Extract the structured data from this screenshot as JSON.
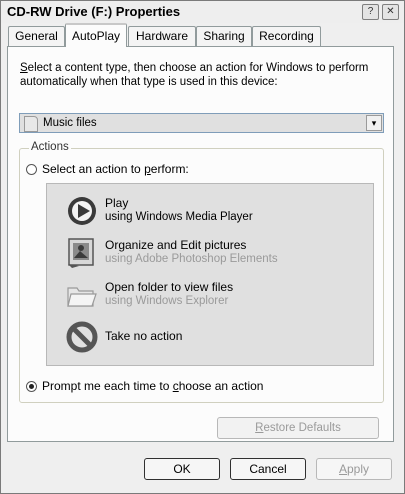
{
  "window": {
    "title": "CD-RW Drive (F:) Properties",
    "help_glyph": "?",
    "close_glyph": "✕"
  },
  "tabs": [
    {
      "label": "General",
      "active": false
    },
    {
      "label": "AutoPlay",
      "active": true
    },
    {
      "label": "Hardware",
      "active": false
    },
    {
      "label": "Sharing",
      "active": false
    },
    {
      "label": "Recording",
      "active": false
    }
  ],
  "description": {
    "before": "",
    "accel": "S",
    "after": "elect a content type, then choose an action for Windows to perform automatically when that type is used in this device:"
  },
  "content_type": {
    "selected": "Music files",
    "icon": "music-file-icon",
    "arrow": "▾"
  },
  "actions_group": {
    "label": "Actions",
    "select_action": {
      "before": "Select an action to ",
      "accel": "p",
      "after": "erform:",
      "checked": false
    },
    "prompt": {
      "before": "Prompt me each time to ",
      "accel": "c",
      "after": "hoose an action",
      "checked": true
    },
    "items": [
      {
        "title": "Play",
        "subtitle": "using Windows Media Player",
        "icon": "media-player-icon",
        "enabled": true
      },
      {
        "title": "Organize and Edit pictures",
        "subtitle": "using Adobe Photoshop Elements",
        "icon": "photoshop-picture-icon",
        "enabled": false
      },
      {
        "title": "Open folder to view files",
        "subtitle": "using Windows Explorer",
        "icon": "folder-icon",
        "enabled": false
      },
      {
        "title": "Take no action",
        "subtitle": "",
        "icon": "no-action-icon",
        "enabled": true
      }
    ]
  },
  "buttons": {
    "restore": {
      "accel": "R",
      "after": "estore Defaults",
      "enabled": false
    },
    "ok": "OK",
    "cancel": "Cancel",
    "apply": {
      "accel": "A",
      "after": "pply",
      "enabled": false
    }
  }
}
